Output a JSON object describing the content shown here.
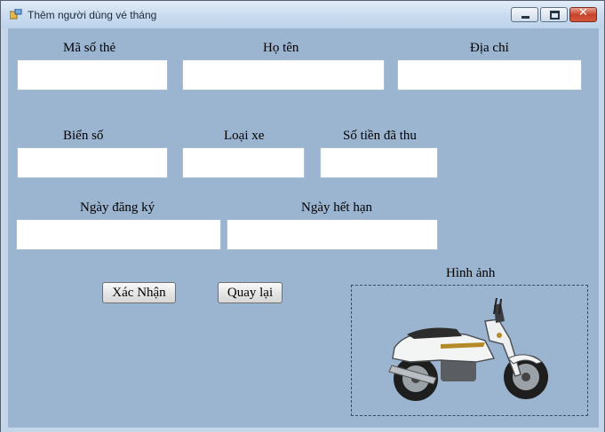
{
  "window": {
    "title": "Thêm người dùng vé tháng",
    "controls": {
      "minimize": "minimize-icon",
      "maximize": "maximize-icon",
      "close": "close-icon"
    }
  },
  "labels": {
    "card_id": "Mã số thẻ",
    "full_name": "Họ tên",
    "address": "Địa chỉ",
    "plate": "Biển số",
    "vehicle_type": "Loại xe",
    "amount_collected": "Số tiền đã thu",
    "register_date": "Ngày đăng ký",
    "expiry_date": "Ngày hết hạn",
    "image": "Hình ảnh"
  },
  "fields": {
    "card_id": "",
    "full_name": "",
    "address": "",
    "plate": "",
    "vehicle_type": "",
    "amount_collected": "",
    "register_date": "",
    "expiry_date": ""
  },
  "buttons": {
    "confirm": "Xác Nhận",
    "back": "Quay lại"
  },
  "colors": {
    "client_bg": "#9bb4d0",
    "textbox_bg": "#ffffff",
    "close_button": "#c8442b"
  }
}
